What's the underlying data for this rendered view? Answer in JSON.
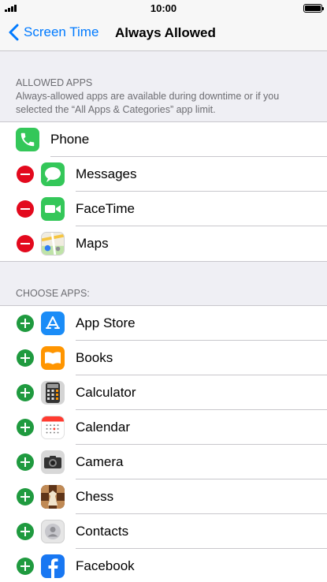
{
  "status_bar": {
    "time": "10:00"
  },
  "nav": {
    "back_label": "Screen Time",
    "title": "Always Allowed"
  },
  "allowed": {
    "header_title": "ALLOWED APPS",
    "header_desc": "Always-allowed apps are available during downtime or if you selected the “All Apps & Categories” app limit.",
    "apps": [
      {
        "label": "Phone",
        "icon": "phone-icon"
      },
      {
        "label": "Messages",
        "icon": "messages-icon"
      },
      {
        "label": "FaceTime",
        "icon": "facetime-icon"
      },
      {
        "label": "Maps",
        "icon": "maps-icon"
      }
    ]
  },
  "choose": {
    "header_title": "CHOOSE APPS:",
    "apps": [
      {
        "label": "App Store",
        "icon": "app-store-icon"
      },
      {
        "label": "Books",
        "icon": "books-icon"
      },
      {
        "label": "Calculator",
        "icon": "calculator-icon"
      },
      {
        "label": "Calendar",
        "icon": "calendar-icon"
      },
      {
        "label": "Camera",
        "icon": "camera-icon"
      },
      {
        "label": "Chess",
        "icon": "chess-icon"
      },
      {
        "label": "Contacts",
        "icon": "contacts-icon"
      },
      {
        "label": "Facebook",
        "icon": "facebook-icon"
      }
    ]
  },
  "colors": {
    "accent": "#007aff",
    "remove": "#e3091d",
    "add": "#1f9a3f"
  }
}
